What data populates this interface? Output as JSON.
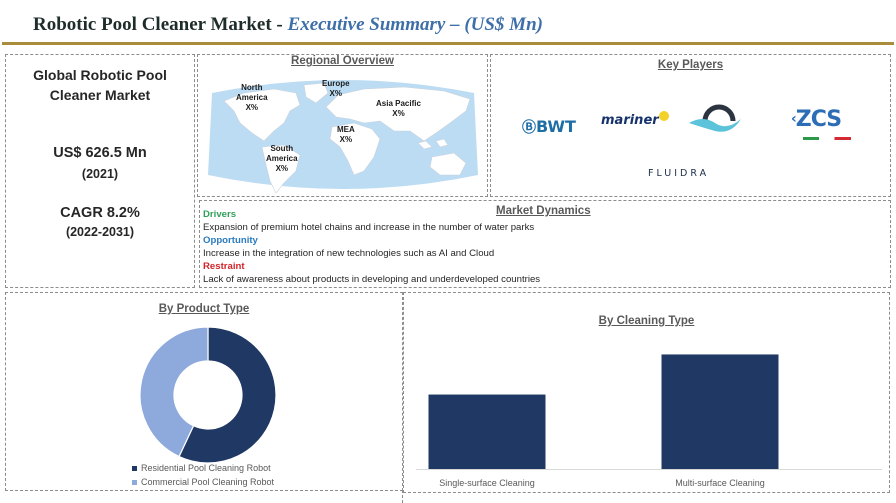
{
  "header": {
    "title_main": "Robotic Pool Cleaner Market - ",
    "title_sub": "Executive Summary – (US$ Mn)"
  },
  "summary": {
    "heading": "Global Robotic Pool Cleaner Market",
    "market_value": "US$ 626.5 Mn",
    "market_year": "(2021)",
    "cagr": "CAGR 8.2%",
    "cagr_period": "(2022-2031)"
  },
  "regional": {
    "title": "Regional Overview",
    "regions": [
      {
        "name": "North America",
        "line1": "North",
        "line2": "America",
        "share": "X%"
      },
      {
        "name": "Europe",
        "line1": "Europe",
        "line2": "",
        "share": "X%"
      },
      {
        "name": "Asia Pacific",
        "line1": "Asia Pacific",
        "line2": "",
        "share": "X%"
      },
      {
        "name": "MEA",
        "line1": "MEA",
        "line2": "",
        "share": "X%"
      },
      {
        "name": "South America",
        "line1": "South",
        "line2": "America",
        "share": "X%"
      }
    ],
    "colors": {
      "ocean": "#bcdcf4",
      "land": "#ffffff"
    }
  },
  "key_players": {
    "title": "Key Players",
    "logos": [
      "BWT",
      "mariner",
      "Wave logo",
      "ZCS",
      "FLUIDRA"
    ]
  },
  "market_dynamics": {
    "title": "Market Dynamics",
    "items": [
      {
        "label": "Drivers",
        "text": "Expansion of premium  hotel chains and increase in the number  of water parks",
        "color": "#2fa05a"
      },
      {
        "label": "Opportunity",
        "text": "Increase in the integration of new technologies such as AI and Cloud",
        "color": "#2a7bbf"
      },
      {
        "label": "Restraint",
        "text": "Lack of awareness about products  in developing and underdeveloped  countries",
        "color": "#d1232a"
      }
    ]
  },
  "chart_data": [
    {
      "type": "pie",
      "donut": true,
      "title": "By Product Type",
      "categories": [
        "Residential Pool Cleaning Robot",
        "Commercial Pool Cleaning Robot"
      ],
      "values": [
        57,
        43
      ],
      "units": "approx. % share (unlabeled)",
      "colors": [
        "#1f3864",
        "#8ea9db"
      ],
      "legend": "bottom"
    },
    {
      "type": "bar",
      "title": "By Cleaning  Type",
      "categories": [
        "Single-surface Cleaning",
        "Multi-surface Cleaning"
      ],
      "values": [
        65,
        100
      ],
      "units": "relative (no axis shown)",
      "ylim": [
        0,
        110
      ],
      "xlabel": "",
      "ylabel": "",
      "grid": false,
      "color": "#1f3864"
    }
  ]
}
